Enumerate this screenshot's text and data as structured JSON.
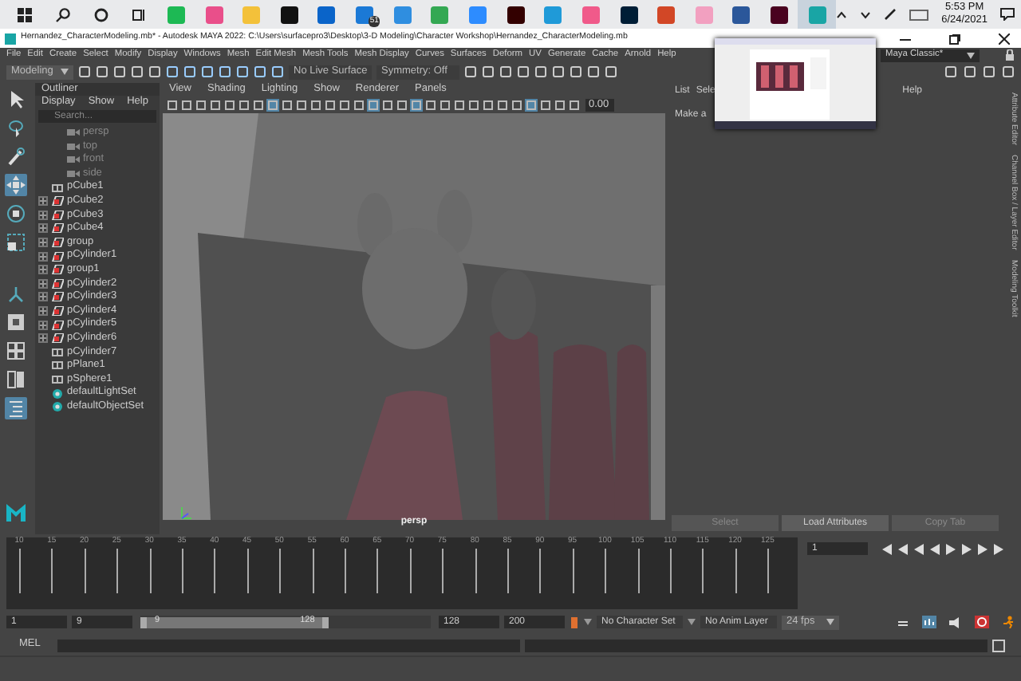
{
  "taskbar": {
    "apps": [
      {
        "color": "#1db954",
        "selected": false
      },
      {
        "color": "#e94f8a",
        "selected": false
      },
      {
        "color": "#f3c13a",
        "selected": false
      },
      {
        "color": "#111111",
        "selected": false
      },
      {
        "color": "#0a64c9",
        "selected": false
      },
      {
        "color": "#1b79d6",
        "selected": false,
        "badge": "51"
      },
      {
        "color": "#2f8ee0",
        "selected": false
      },
      {
        "color": "#34a853",
        "selected": false
      },
      {
        "color": "#2d8cff",
        "selected": false
      },
      {
        "color": "#330000",
        "selected": false
      },
      {
        "color": "#1f9ad8",
        "selected": false
      },
      {
        "color": "#f05a8a",
        "selected": false
      },
      {
        "color": "#001e36",
        "selected": false
      },
      {
        "color": "#d24726",
        "selected": false
      },
      {
        "color": "#f2a0c0",
        "selected": false
      },
      {
        "color": "#2b579a",
        "selected": false
      },
      {
        "color": "#49021f",
        "selected": false
      },
      {
        "color": "#19a5a5",
        "selected": true
      }
    ],
    "time": "5:53 PM",
    "date": "6/24/2021"
  },
  "window": {
    "title": "Hernandez_CharacterModeling.mb* - Autodesk MAYA 2022: C:\\Users\\surfacepro3\\Desktop\\3-D Modeling\\Character Workshop\\Hernandez_CharacterModeling.mb"
  },
  "menu": [
    "File",
    "Edit",
    "Create",
    "Select",
    "Modify",
    "Display",
    "Windows",
    "Mesh",
    "Edit Mesh",
    "Mesh Tools",
    "Mesh Display",
    "Curves",
    "Surfaces",
    "Deform",
    "UV",
    "Generate",
    "Cache",
    "Arnold",
    "Help"
  ],
  "workspace": "Maya Classic*",
  "shelf": {
    "menu_set": "Modeling",
    "live_surface": "No Live Surface",
    "symmetry": "Symmetry: Off"
  },
  "toolbox": [
    {
      "kind": "select",
      "selected": false
    },
    {
      "kind": "lasso",
      "selected": false
    },
    {
      "kind": "paint",
      "selected": false
    },
    {
      "kind": "move",
      "selected": true
    },
    {
      "kind": "rotate",
      "selected": false
    },
    {
      "kind": "scale",
      "selected": false
    },
    {
      "kind": "soft",
      "selected": false
    },
    {
      "kind": "single",
      "selected": false
    },
    {
      "kind": "four",
      "selected": false
    },
    {
      "kind": "two",
      "selected": false
    },
    {
      "kind": "outliner",
      "selected": true
    }
  ],
  "outliner": {
    "title": "Outliner",
    "menus": [
      "Display",
      "Show",
      "Help"
    ],
    "search": {
      "placeholder": "Search..."
    },
    "items": [
      {
        "label": "persp",
        "kind": "camera",
        "expandable": false
      },
      {
        "label": "top",
        "kind": "camera",
        "expandable": false
      },
      {
        "label": "front",
        "kind": "camera",
        "expandable": false
      },
      {
        "label": "side",
        "kind": "camera",
        "expandable": false
      },
      {
        "label": "pCube1",
        "kind": "group",
        "expandable": false
      },
      {
        "label": "pCube2",
        "kind": "mesh",
        "expandable": true
      },
      {
        "label": "pCube3",
        "kind": "mesh",
        "expandable": true
      },
      {
        "label": "pCube4",
        "kind": "mesh",
        "expandable": true
      },
      {
        "label": "group",
        "kind": "mesh",
        "expandable": true
      },
      {
        "label": "pCylinder1",
        "kind": "mesh",
        "expandable": true
      },
      {
        "label": "group1",
        "kind": "mesh",
        "expandable": true
      },
      {
        "label": "pCylinder2",
        "kind": "mesh",
        "expandable": true
      },
      {
        "label": "pCylinder3",
        "kind": "mesh",
        "expandable": true
      },
      {
        "label": "pCylinder4",
        "kind": "mesh",
        "expandable": true
      },
      {
        "label": "pCylinder5",
        "kind": "mesh",
        "expandable": true
      },
      {
        "label": "pCylinder6",
        "kind": "mesh",
        "expandable": true
      },
      {
        "label": "pCylinder7",
        "kind": "group",
        "expandable": false
      },
      {
        "label": "pPlane1",
        "kind": "group",
        "expandable": false
      },
      {
        "label": "pSphere1",
        "kind": "group",
        "expandable": false
      },
      {
        "label": "defaultLightSet",
        "kind": "set",
        "expandable": false
      },
      {
        "label": "defaultObjectSet",
        "kind": "set",
        "expandable": false
      }
    ]
  },
  "viewport": {
    "menus": [
      "View",
      "Shading",
      "Lighting",
      "Show",
      "Renderer",
      "Panels"
    ],
    "tools": [
      {
        "selected": false
      },
      {
        "selected": false
      },
      {
        "selected": false
      },
      {
        "selected": false
      },
      {
        "selected": false
      },
      {
        "selected": false
      },
      {
        "selected": false
      },
      {
        "selected": true
      },
      {
        "selected": false
      },
      {
        "selected": false
      },
      {
        "selected": false
      },
      {
        "selected": false
      },
      {
        "selected": false
      },
      {
        "selected": false
      },
      {
        "selected": true
      },
      {
        "selected": false
      },
      {
        "selected": false
      },
      {
        "selected": true
      },
      {
        "selected": false
      },
      {
        "selected": false
      },
      {
        "selected": false
      },
      {
        "selected": false
      },
      {
        "selected": false
      },
      {
        "selected": false
      },
      {
        "selected": false
      },
      {
        "selected": true
      },
      {
        "selected": false
      },
      {
        "selected": false
      },
      {
        "selected": false
      }
    ],
    "exposure": "0.00",
    "camera": "persp"
  },
  "attribute_editor": {
    "menus": [
      "List",
      "Sele",
      "Help"
    ],
    "message": "Make a",
    "buttons": [
      "Select",
      "Load Attributes",
      "Copy Tab"
    ],
    "side_tabs": [
      "Attribute Editor",
      "Channel Box / Layer Editor",
      "Modeling Toolkit"
    ]
  },
  "timeline": {
    "ticks": [
      "10",
      "15",
      "20",
      "25",
      "30",
      "35",
      "40",
      "45",
      "50",
      "55",
      "60",
      "65",
      "70",
      "75",
      "80",
      "85",
      "90",
      "95",
      "100",
      "105",
      "110",
      "115",
      "120",
      "125"
    ],
    "current_frame": "1"
  },
  "range": {
    "start": "1",
    "playback_start": "9",
    "slider_start": "9",
    "slider_end": "128",
    "playback_end": "128",
    "end": "200",
    "character_set": "No Character Set",
    "anim_layer": "No Anim Layer",
    "fps": "24 fps",
    "level": 0.65
  },
  "command_line": {
    "language": "MEL"
  }
}
